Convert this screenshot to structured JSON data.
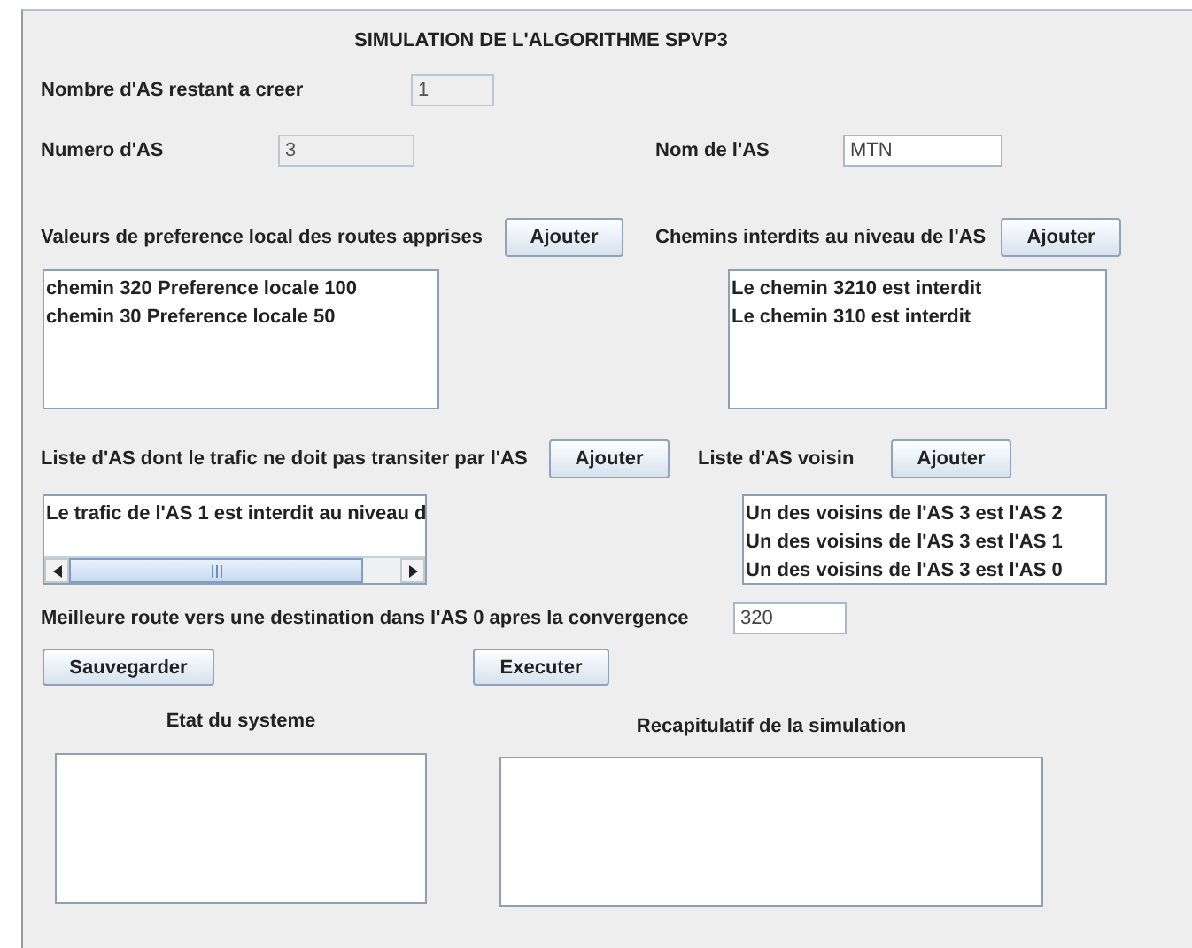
{
  "title": "SIMULATION DE L'ALGORITHME SPVP3",
  "remaining": {
    "label": "Nombre d'AS restant a creer",
    "value": "1",
    "disabled": true
  },
  "as_number": {
    "label": "Numero d'AS",
    "value": "3",
    "disabled": true
  },
  "as_name": {
    "label": "Nom de l'AS",
    "value": "MTN",
    "disabled": false
  },
  "preferences": {
    "label": "Valeurs de preference local des routes apprises",
    "button": "Ajouter",
    "items": [
      "chemin 320 Preference locale 100",
      "chemin 30 Preference locale 50"
    ]
  },
  "forbidden_paths": {
    "label": "Chemins interdits au niveau de l'AS",
    "button": "Ajouter",
    "items": [
      "Le chemin 3210 est interdit",
      "Le chemin 310 est interdit"
    ]
  },
  "transit_ban": {
    "label": "Liste d'AS dont le trafic ne doit pas transiter par l'AS",
    "button": "Ajouter",
    "items": [
      "Le trafic de l'AS 1 est interdit au niveau d"
    ]
  },
  "neighbors": {
    "label": "Liste d'AS voisin",
    "button": "Ajouter",
    "items": [
      "Un des voisins de l'AS 3 est l'AS 2",
      "Un des voisins de l'AS 3 est l'AS 1",
      "Un des voisins de l'AS 3 est l'AS 0"
    ]
  },
  "best_route": {
    "label": "Meilleure route vers une destination dans l'AS 0 apres la convergence",
    "value": "320",
    "disabled": false
  },
  "buttons": [
    "Sauvegarder",
    "Executer"
  ],
  "system_state": {
    "label": "Etat du systeme"
  },
  "summary": {
    "label": "Recapitulatif de la simulation"
  }
}
